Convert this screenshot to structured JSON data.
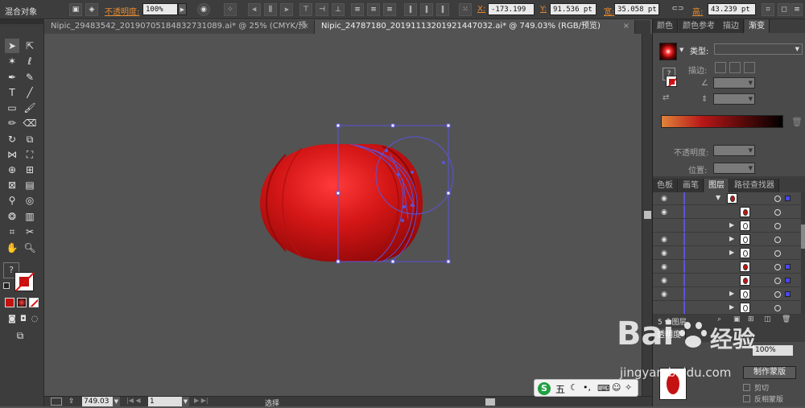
{
  "control_bar": {
    "object_label": "混合对象",
    "opacity_label": "不透明度:",
    "opacity_value": "100%",
    "x_label": "X:",
    "x_value": "-173.199",
    "y_label": "Y:",
    "y_value": "91.536 pt",
    "width_label": "宽:",
    "width_value": "35.058 pt",
    "height_label": "高:",
    "height_value": "43.239 pt"
  },
  "document_tabs": [
    {
      "label": "Nipic_29483542_20190705184832731089.ai* @ 25% (CMYK/预览)",
      "close": "×"
    },
    {
      "label": "Nipic_24787180_20191113201921447032.ai* @ 749.03% (RGB/预览)",
      "close": "×"
    }
  ],
  "toolbar": {
    "tools": [
      "selection",
      "direct-selection",
      "magic-wand",
      "lasso",
      "pen",
      "curvature",
      "type",
      "line",
      "rectangle",
      "paintbrush",
      "pencil",
      "eraser",
      "rotate",
      "scale",
      "width",
      "free-transform",
      "shape-builder",
      "perspective",
      "mesh",
      "gradient",
      "eyedropper",
      "blend",
      "symbol-sprayer",
      "column-graph",
      "artboard",
      "slice",
      "hand",
      "zoom"
    ],
    "fill_stroke_question": "?",
    "fill_color": "#c41212",
    "stroke_color": "#ffffff"
  },
  "panel_top": {
    "tabs": [
      "颜色",
      "颜色参考",
      "描边",
      "渐变"
    ],
    "active_tab": "渐变",
    "type_label": "类型:",
    "stroke_label": "描边:",
    "opacity_label": "不透明度:",
    "position_label": "位置:",
    "gradient_stops": [
      "#e0843a",
      "#b81818",
      "#5a0a0a",
      "#000000"
    ]
  },
  "panel_layers": {
    "tabs": [
      "色板",
      "画笔",
      "图层",
      "路径查找器"
    ],
    "active_tab": "图层",
    "layer_count": "5 个图层",
    "rows": 9
  },
  "panel_transparency": {
    "tab": "透明度",
    "opacity_value": "100%",
    "make_mask_button": "制作蒙版",
    "clip_label": "剪切",
    "invert_label": "反相蒙版"
  },
  "status_bar": {
    "zoom": "749.03",
    "page": "1",
    "tool_label": "选择"
  },
  "ime_bar": {
    "mode": "五"
  },
  "watermark": {
    "brand": "Bai",
    "brand2": "经验",
    "url": "jingyan.baidu.com"
  },
  "colors": {
    "accent_orange": "#e88a2e",
    "selection_blue": "#5a55d8",
    "lantern_red": "#c41212"
  }
}
